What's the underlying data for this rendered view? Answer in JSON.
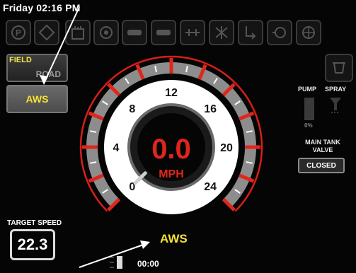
{
  "status_bar": {
    "clock": "Friday 02:16 PM"
  },
  "toolbar": {
    "icons": [
      "parking-brake-icon",
      "steering-icon",
      "tank-level-icon",
      "engine-icon",
      "track-left-icon",
      "track-right-icon",
      "boom-icon",
      "fan-icon",
      "pto-icon",
      "pump-icon",
      "nozzle-icon"
    ]
  },
  "mode_panel": {
    "field_label": "FIELD",
    "road_label": "ROAD",
    "aws_label": "AWS"
  },
  "gauge": {
    "speed": "0.0",
    "unit": "MPH",
    "speed_value": 0,
    "ticks": [
      "0",
      "4",
      "8",
      "12",
      "16",
      "20",
      "24"
    ],
    "range": [
      0,
      24
    ],
    "mode_label": "AWS"
  },
  "spray_panel": {
    "pump_label": "PUMP",
    "spray_label": "SPRAY",
    "pump_percent": "0%",
    "tank_valve_label": "MAIN TANK VALVE",
    "valve_state": "CLOSED"
  },
  "target_speed": {
    "label": "TARGET SPEED",
    "value": "22.3"
  },
  "footer": {
    "timer": "00:00"
  },
  "colors": {
    "accent_red": "#e0261c",
    "label_yellow": "#f4e332",
    "panel_gray": "#4c4c4c"
  }
}
